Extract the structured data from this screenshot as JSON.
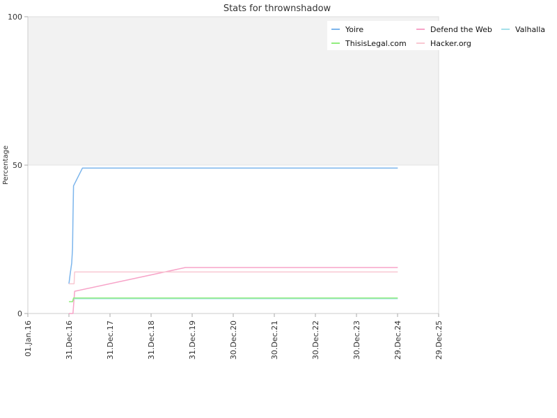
{
  "chart_data": {
    "type": "line",
    "title": "Stats for thrownshadow",
    "xlabel": "",
    "ylabel": "Percentage",
    "ylim": [
      0,
      100
    ],
    "y_ticks": [
      0,
      50,
      100
    ],
    "xlim": [
      "2016-01-01",
      "2025-12-29"
    ],
    "x_ticks": [
      "01.Jan.16",
      "31.Dec.16",
      "31.Dec.17",
      "31.Dec.18",
      "31.Dec.19",
      "30.Dec.20",
      "30.Dec.21",
      "30.Dec.22",
      "30.Dec.23",
      "29.Dec.24",
      "29.Dec.25"
    ],
    "x_tick_dates": [
      "2016-01-01",
      "2016-12-31",
      "2017-12-31",
      "2018-12-31",
      "2019-12-31",
      "2020-12-30",
      "2021-12-30",
      "2022-12-30",
      "2023-12-30",
      "2024-12-29",
      "2025-12-29"
    ],
    "grid": false,
    "legend_position": "top-right",
    "upper_band": {
      "from": 50,
      "to": 100,
      "color": "#f2f2f2"
    },
    "series": [
      {
        "name": "Yoire",
        "color": "#7cb5ec",
        "points": [
          [
            "2016-12-31",
            10
          ],
          [
            "2017-01-10",
            13
          ],
          [
            "2017-01-25",
            17
          ],
          [
            "2017-02-01",
            22
          ],
          [
            "2017-02-05",
            32
          ],
          [
            "2017-02-10",
            43
          ],
          [
            "2017-04-30",
            49
          ],
          [
            "2024-12-31",
            49
          ]
        ]
      },
      {
        "name": "Defend the Web",
        "color": "#f7a3c8",
        "points": [
          [
            "2016-12-31",
            0
          ],
          [
            "2017-02-05",
            0
          ],
          [
            "2017-02-20",
            7.5
          ],
          [
            "2019-11-01",
            15.5
          ],
          [
            "2024-12-31",
            15.5
          ]
        ]
      },
      {
        "name": "Valhalla",
        "color": "#a4e0ea",
        "points": [
          [
            "2017-02-10",
            5
          ],
          [
            "2024-12-31",
            5
          ]
        ]
      },
      {
        "name": "ThisisLegal.com",
        "color": "#90ed7d",
        "points": [
          [
            "2016-12-31",
            4
          ],
          [
            "2017-02-01",
            4
          ],
          [
            "2017-02-10",
            5.2
          ],
          [
            "2024-12-31",
            5.2
          ]
        ]
      },
      {
        "name": "Hacker.org",
        "color": "#f9c8d2",
        "points": [
          [
            "2016-12-31",
            10
          ],
          [
            "2017-02-15",
            10
          ],
          [
            "2017-02-20",
            14
          ],
          [
            "2024-12-31",
            14
          ]
        ]
      }
    ]
  }
}
